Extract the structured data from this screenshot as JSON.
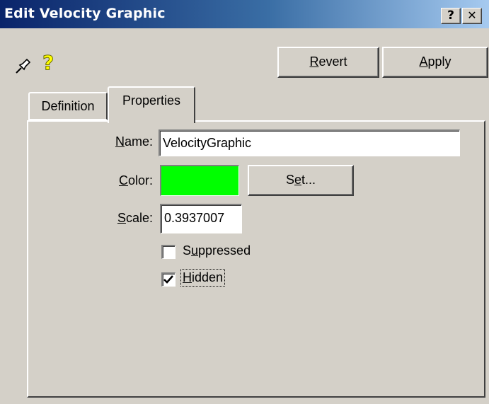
{
  "window": {
    "title": "Edit Velocity Graphic",
    "help_button": "?",
    "close_button": "✕",
    "colors": {
      "title_start": "#0a246a",
      "title_end": "#a6caf0",
      "face": "#d4d0c8"
    }
  },
  "toolbar": {
    "pin_icon": "pin-icon",
    "help_icon": "?",
    "revert_label": "Revert",
    "apply_label": "Apply"
  },
  "tabs": [
    {
      "label": "Definition",
      "active": false
    },
    {
      "label": "Properties",
      "active": true
    }
  ],
  "properties": {
    "name_label": "Name:",
    "name_value": "VelocityGraphic",
    "color_label": "Color:",
    "color_value": "#00ff00",
    "set_button": "Set...",
    "scale_label": "Scale:",
    "scale_value": "0.3937007",
    "suppressed_label": "Suppressed",
    "suppressed_checked": false,
    "hidden_label": "Hidden",
    "hidden_checked": true
  }
}
